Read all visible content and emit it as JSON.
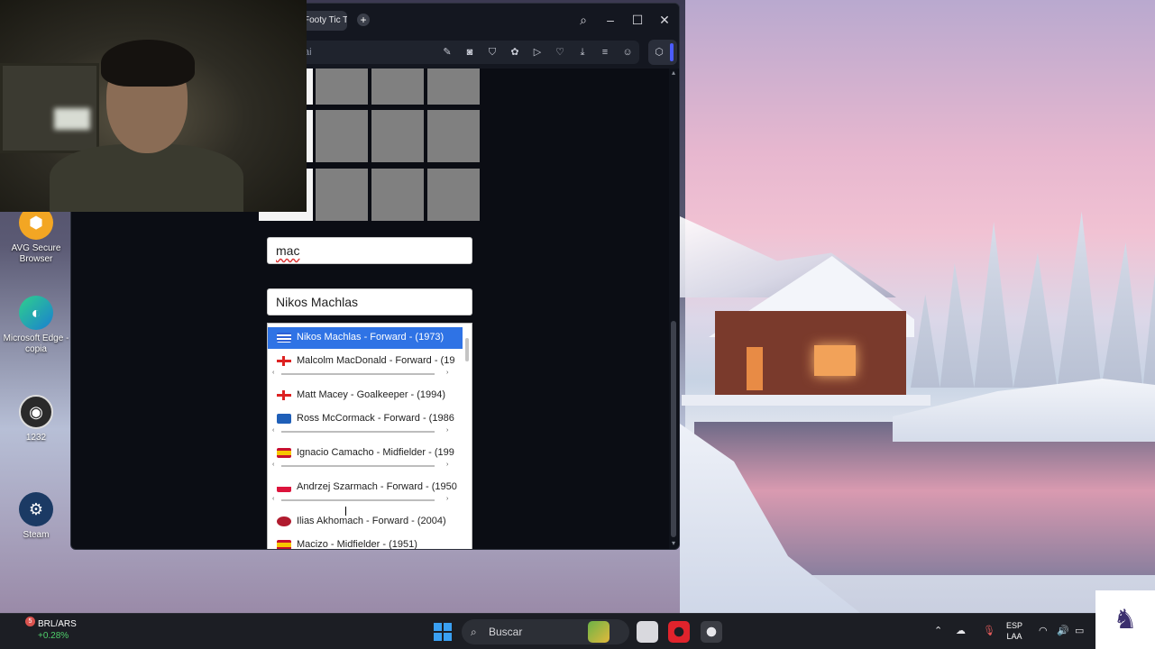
{
  "desktop": {
    "icons": [
      {
        "label": "AVG Secure Browser",
        "glyph": "⬢"
      },
      {
        "label": "Microsoft Edge - copia",
        "glyph": "◐"
      },
      {
        "label": "1232",
        "glyph": "◉"
      },
      {
        "label": "Steam",
        "glyph": "⚙"
      }
    ]
  },
  "browser": {
    "tab_title": "Footy Tic T",
    "url_text": "ai",
    "icons": [
      "edit-icon",
      "camera-icon",
      "shield-icon",
      "extensions-icon",
      "play-icon",
      "heart-icon",
      "download-icon",
      "menu-icon",
      "account-icon",
      "cube-icon"
    ]
  },
  "game": {
    "search_value": "mac",
    "selected_value": "Nikos Machlas"
  },
  "dropdown": {
    "items": [
      {
        "label": "Nikos Machlas - Forward - (1973)",
        "flag": "greece"
      },
      {
        "label": "Malcolm MacDonald - Forward - (19",
        "flag": "england"
      },
      {
        "label": "Matt Macey - Goalkeeper - (1994)",
        "flag": "england"
      },
      {
        "label": "Ross McCormack - Forward - (1986",
        "flag": "scotland"
      },
      {
        "label": "Ignacio Camacho - Midfielder - (199",
        "flag": "spain"
      },
      {
        "label": "Andrzej Szarmach - Forward - (1950",
        "flag": "poland"
      },
      {
        "label": "Ilias Akhomach - Forward - (2004)",
        "flag": "morocco"
      },
      {
        "label": "Macizo - Midfielder - (1951)",
        "flag": "spain"
      }
    ]
  },
  "taskbar": {
    "stock_name": "BRL/ARS",
    "stock_change": "+0.28%",
    "badge_count": "5",
    "search_label": "Buscar",
    "lang_line1": "ESP",
    "lang_line2": "LAA"
  },
  "colors": {
    "selection": "#2f73e5",
    "grid_cell": "#808080",
    "browser_bg": "#0b0d14"
  }
}
